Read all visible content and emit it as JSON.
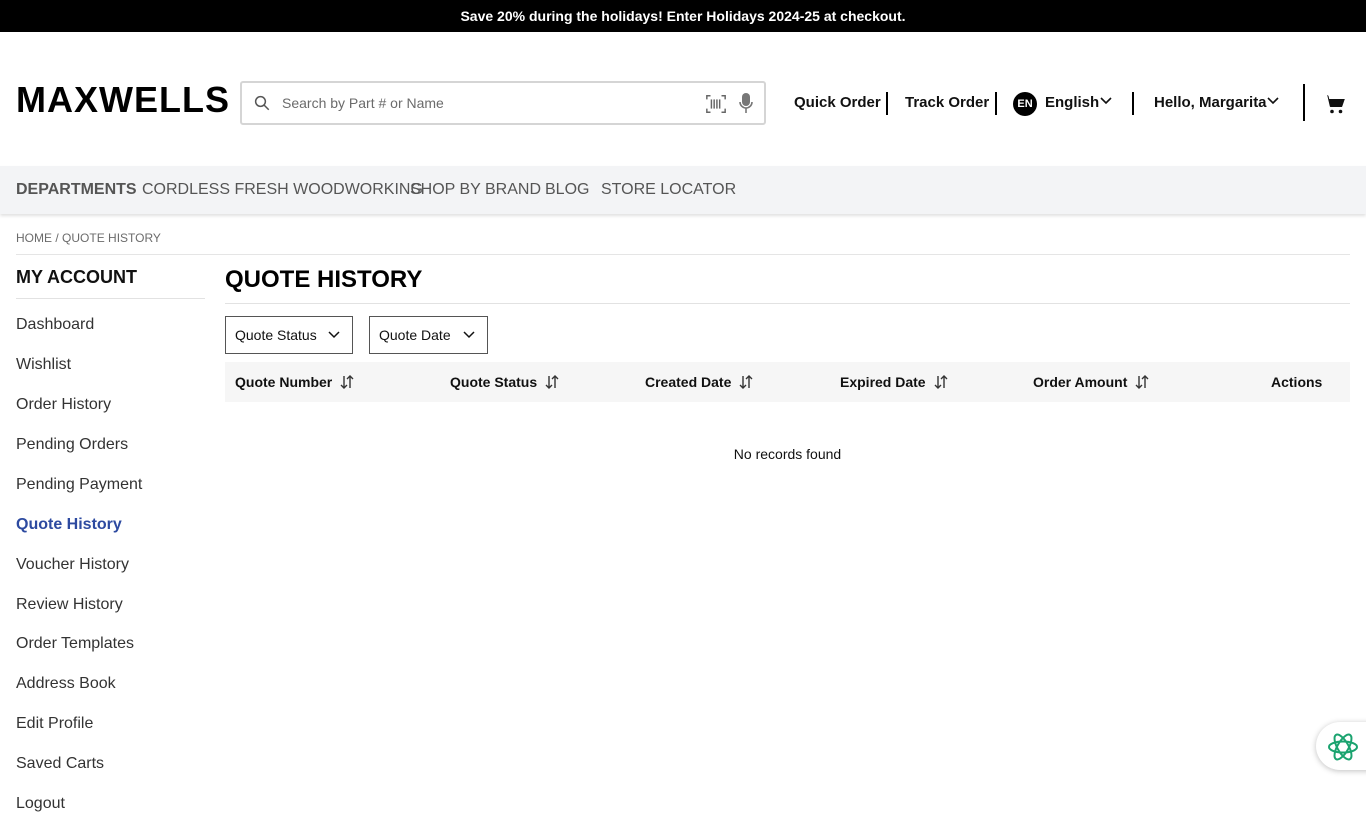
{
  "promo": {
    "text": "Save 20% during the holidays! Enter Holidays 2024-25 at checkout."
  },
  "header": {
    "logo": "MAXWELLS",
    "search": {
      "placeholder": "Search by Part # or Name",
      "value": ""
    },
    "links": {
      "quick_order": "Quick Order",
      "track_order": "Track Order"
    },
    "language": {
      "badge": "EN",
      "label": "English"
    },
    "user": {
      "greeting": "Hello, Margarita"
    },
    "icons": [
      "search-icon",
      "barcode-scan-icon",
      "microphone-icon",
      "chevron-down-icon",
      "cart-icon"
    ]
  },
  "nav": {
    "items": [
      "DEPARTMENTS",
      "CORDLESS FRESH WOODWORKING",
      "SHOP BY BRAND",
      "BLOG",
      "STORE LOCATOR"
    ]
  },
  "breadcrumb": {
    "home": "HOME",
    "separator": "/",
    "current": "QUOTE HISTORY"
  },
  "sidebar": {
    "title": "MY ACCOUNT",
    "items": [
      {
        "label": "Dashboard"
      },
      {
        "label": "Wishlist"
      },
      {
        "label": "Order History"
      },
      {
        "label": "Pending Orders"
      },
      {
        "label": "Pending Payment"
      },
      {
        "label": "Quote History",
        "active": true
      },
      {
        "label": "Voucher History"
      },
      {
        "label": "Review History"
      },
      {
        "label": "Order Templates"
      },
      {
        "label": "Address Book"
      },
      {
        "label": "Edit Profile"
      },
      {
        "label": "Saved Carts"
      },
      {
        "label": "Logout"
      }
    ],
    "active_color": "#2d4aa0"
  },
  "main": {
    "title": "QUOTE HISTORY",
    "filters": [
      "Quote Status",
      "Quote Date"
    ],
    "table": {
      "columns": [
        "Quote Number",
        "Quote Status",
        "Created Date",
        "Expired Date",
        "Order Amount",
        "Actions"
      ],
      "rows": [],
      "empty_message": "No records found"
    }
  },
  "chat_widget": {
    "icon": "ai-assistant-icon",
    "color": "#1aa36f"
  }
}
